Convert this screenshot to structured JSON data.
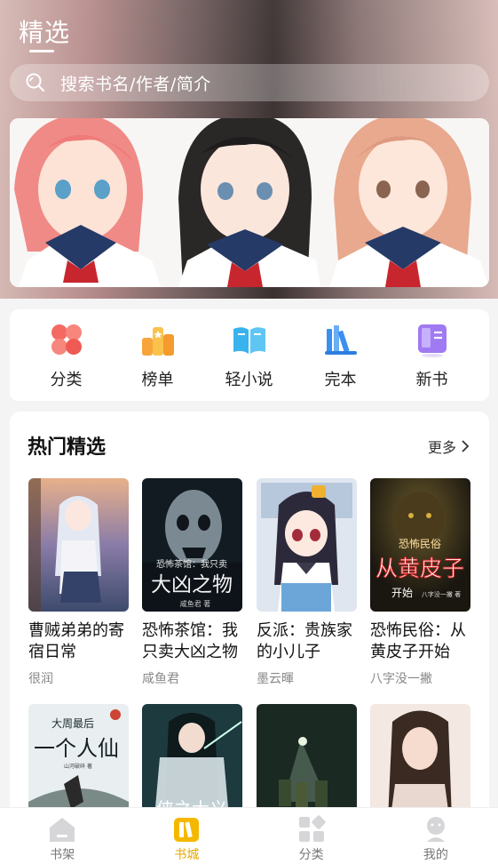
{
  "header": {
    "title": "精选"
  },
  "search": {
    "placeholder": "搜索书名/作者/简介"
  },
  "quick_links": [
    {
      "label": "分类",
      "icon": "category-flower-icon",
      "color": "#f0605a"
    },
    {
      "label": "榜单",
      "icon": "ranking-podium-icon",
      "color": "#f5a623"
    },
    {
      "label": "轻小说",
      "icon": "open-book-icon",
      "color": "#3aaee8"
    },
    {
      "label": "完本",
      "icon": "book-stack-icon",
      "color": "#3b8ff0"
    },
    {
      "label": "新书",
      "icon": "new-book-icon",
      "color": "#9a6cf0"
    }
  ],
  "hot": {
    "title": "热门精选",
    "more_label": "更多",
    "books": [
      {
        "title": "曹贼弟弟的寄宿日常",
        "author": "很润"
      },
      {
        "title": "恐怖茶馆：我只卖大凶之物",
        "author": "咸鱼君"
      },
      {
        "title": "反派：贵族家的小儿子",
        "author": "墨云暉"
      },
      {
        "title": "恐怖民俗：从黄皮子开始",
        "author": "八字没一撇"
      }
    ],
    "second_row_cover_text": [
      "大周最后一个人仙",
      "侠之大义"
    ],
    "cover_labels": {
      "book2_top": "恐怖茶馆：我只卖",
      "book2_main": "大凶之物",
      "book2_author": "咸鱼君 著",
      "book4_top": "恐怖民俗",
      "book4_main": "从黄皮子",
      "book4_sub": "开始",
      "book4_author": "八字没一撇 著",
      "book5_top": "大周最后",
      "book5_main": "一个人仙",
      "book5_author": "山河破碎 著",
      "book6_main": "侠之大义"
    }
  },
  "tabbar": {
    "tabs": [
      {
        "label": "书架",
        "icon": "bookshelf-icon",
        "active": false
      },
      {
        "label": "书城",
        "icon": "bookstore-icon",
        "active": true
      },
      {
        "label": "分类",
        "icon": "category-grid-icon",
        "active": false
      },
      {
        "label": "我的",
        "icon": "profile-icon",
        "active": false
      }
    ],
    "active_color": "#e6a800"
  }
}
